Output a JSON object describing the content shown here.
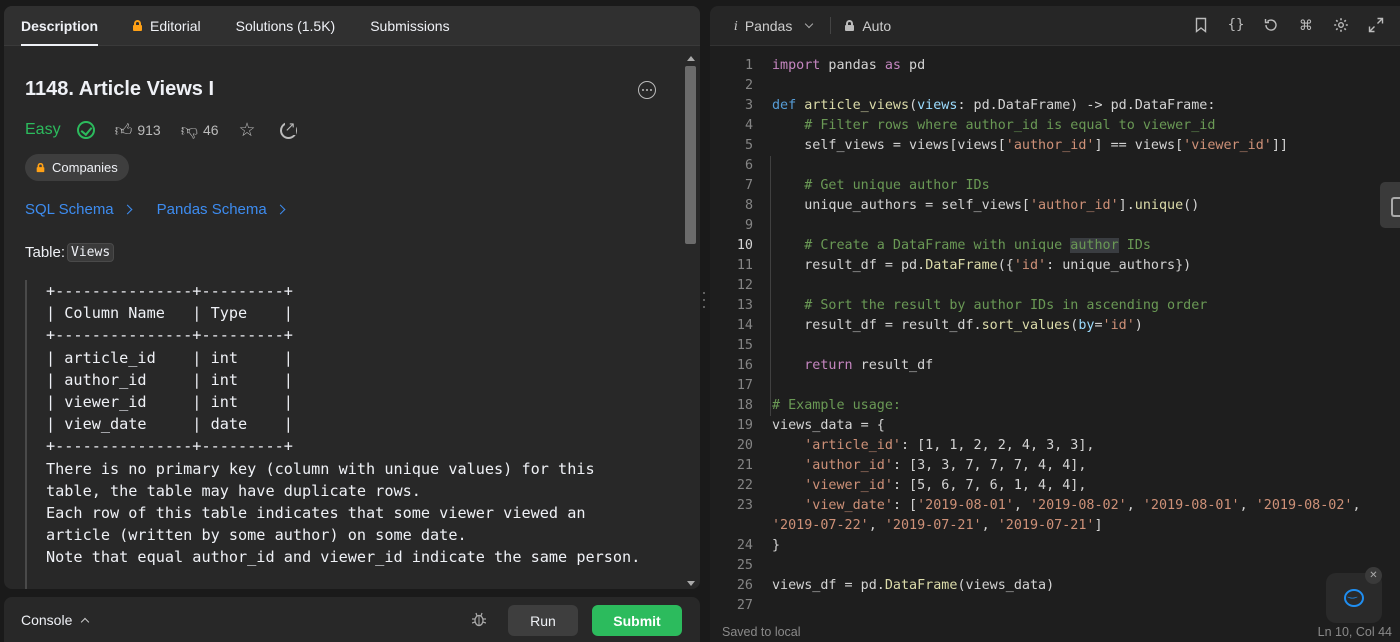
{
  "left_tabs": {
    "description": "Description",
    "editorial": "Editorial",
    "solutions": "Solutions (1.5K)",
    "submissions": "Submissions"
  },
  "problem": {
    "title": "1148. Article Views I",
    "difficulty": "Easy",
    "likes": "913",
    "dislikes": "46",
    "companies_label": "Companies",
    "sql_schema": "SQL Schema",
    "pandas_schema": "Pandas Schema",
    "table_label": "Table:",
    "table_name": "Views",
    "schema_lines": [
      "+---------------+---------+",
      "| Column Name   | Type    |",
      "+---------------+---------+",
      "| article_id    | int     |",
      "| author_id     | int     |",
      "| viewer_id     | int     |",
      "| view_date     | date    |",
      "+---------------+---------+",
      "There is no primary key (column with unique values) for this",
      "table, the table may have duplicate rows.",
      "Each row of this table indicates that some viewer viewed an",
      "article (written by some author) on some date.",
      "Note that equal author_id and viewer_id indicate the same person."
    ]
  },
  "console": {
    "label": "Console",
    "run": "Run",
    "submit": "Submit"
  },
  "editor": {
    "language": "Pandas",
    "lang_glyph": "i",
    "mode": "Auto",
    "current_line": 10,
    "status_left": "Saved to local",
    "status_right": "Ln 10, Col 44",
    "tool_icons": [
      "bookmark-icon",
      "braces-icon",
      "reset-icon",
      "command-icon",
      "settings-icon",
      "expand-icon"
    ]
  },
  "code_lines": [
    "import pandas as pd",
    "",
    "def article_views(views: pd.DataFrame) -> pd.DataFrame:",
    "    # Filter rows where author_id is equal to viewer_id",
    "    self_views = views[views['author_id'] == views['viewer_id']]",
    "",
    "    # Get unique author IDs",
    "    unique_authors = self_views['author_id'].unique()",
    "",
    "    # Create a DataFrame with unique author IDs",
    "    result_df = pd.DataFrame({'id': unique_authors})",
    "",
    "    # Sort the result by author IDs in ascending order",
    "    result_df = result_df.sort_values(by='id')",
    "",
    "    return result_df",
    "",
    "# Example usage:",
    "views_data = {",
    "    'article_id': [1, 1, 2, 2, 4, 3, 3],",
    "    'author_id': [3, 3, 7, 7, 7, 4, 4],",
    "    'viewer_id': [5, 6, 7, 6, 1, 4, 4],",
    "    'view_date': ['2019-08-01', '2019-08-02', '2019-08-01', '2019-08-02',",
    "'2019-07-22', '2019-07-21', '2019-07-21']",
    "}",
    "",
    "views_df = pd.DataFrame(views_data)",
    ""
  ],
  "line_numbers": [
    "1",
    "2",
    "3",
    "4",
    "5",
    "6",
    "7",
    "8",
    "9",
    "10",
    "11",
    "12",
    "13",
    "14",
    "15",
    "16",
    "17",
    "18",
    "19",
    "20",
    "21",
    "22",
    "23",
    "",
    "24",
    "25",
    "26",
    "27"
  ],
  "colors": {
    "easy": "#2cbb5d",
    "link": "#3d8cf0",
    "submit": "#2cbb5d",
    "lock": "#ffa116"
  }
}
